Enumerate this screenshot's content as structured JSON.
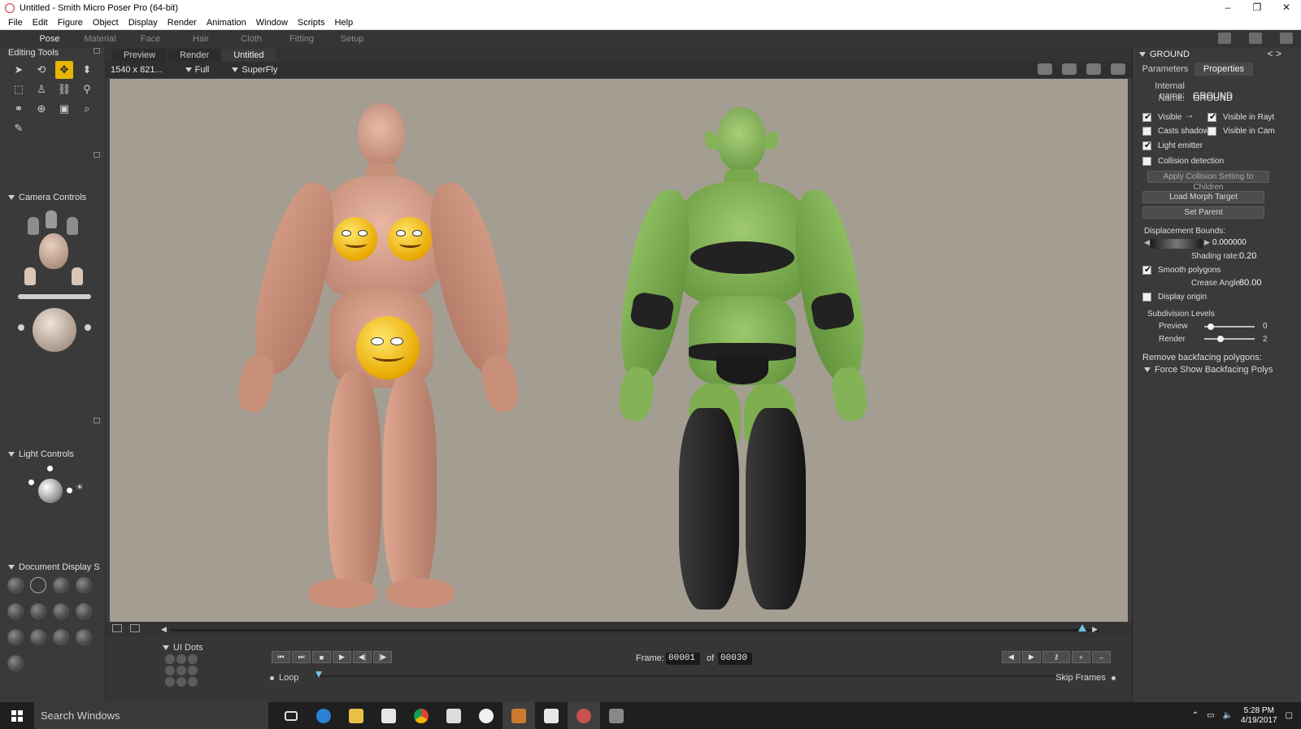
{
  "window": {
    "title": "Untitled - Smith Micro Poser Pro  (64-bit)",
    "controls": [
      "–",
      "❐",
      "✕"
    ]
  },
  "menu": [
    "File",
    "Edit",
    "Figure",
    "Object",
    "Display",
    "Render",
    "Animation",
    "Window",
    "Scripts",
    "Help"
  ],
  "room_tabs": [
    "Pose",
    "Material",
    "Face",
    "Hair",
    "Cloth",
    "Fitting",
    "Setup"
  ],
  "left": {
    "editing_tools": "Editing Tools",
    "camera_controls": "Camera Controls",
    "light_controls": "Light Controls",
    "document_display": "Document Display S"
  },
  "doc": {
    "tabs": [
      "Preview",
      "Render"
    ],
    "doc_title": "Untitled",
    "size": "1540 x 821...",
    "mode": "Full",
    "renderer": "SuperFly"
  },
  "bottom": {
    "ui_dots": "UI Dots",
    "frame_label": "Frame:",
    "frame_current": "00001",
    "of_label": "of",
    "frame_total": "00030",
    "loop": "Loop",
    "skip_frames": "Skip Frames"
  },
  "right": {
    "object": "GROUND",
    "tabs": [
      "Parameters",
      "Properties"
    ],
    "internal_name_label": "Internal name:",
    "internal_name": "GROUND",
    "name_label": "Name:",
    "name": "GROUND",
    "visible": "Visible",
    "visible_in_rayt": "Visible in Rayt",
    "casts_shadows": "Casts shadows",
    "visible_in_cam": "Visible in Cam",
    "light_emitter": "Light emitter",
    "collision_detection": "Collision detection",
    "apply_collision": "Apply Collision Setting to Children",
    "load_morph": "Load Morph Target",
    "set_parent": "Set Parent",
    "displacement_bounds": "Displacement Bounds:",
    "displacement_value": "0.000000",
    "shading_rate_label": "Shading rate:",
    "shading_rate": "0.20",
    "smooth_polygons": "Smooth polygons",
    "crease_angle_label": "Crease Angle",
    "crease_angle": "80.00",
    "display_origin": "Display origin",
    "subdivision_levels": "Subdivision Levels",
    "preview_label": "Preview",
    "preview_value": "0",
    "render_label": "Render",
    "render_value": "2",
    "remove_backfacing": "Remove backfacing polygons:",
    "force_show": "Force Show Backfacing Polys"
  },
  "taskbar": {
    "search": "Search Windows",
    "time": "5:28 PM",
    "date": "4/19/2017"
  },
  "colors": {
    "viewport_bg": "#a49d92",
    "active_tool": "#e8b400",
    "timeline_knob": "#6fc3e6"
  }
}
